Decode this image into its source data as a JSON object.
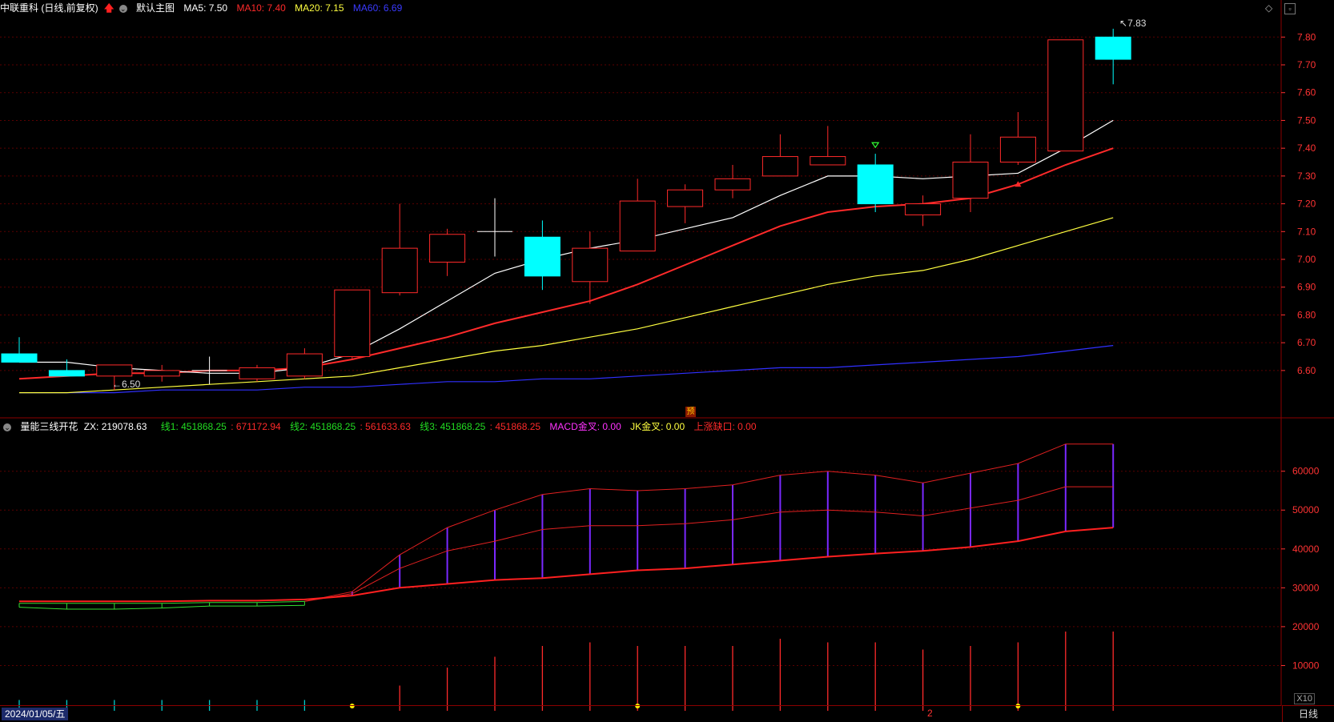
{
  "header": {
    "stock_name": "中联重科 (日线,前复权)",
    "template_label": "默认主图",
    "ma5": "MA5: 7.50",
    "ma10": "MA10: 7.40",
    "ma20": "MA20: 7.15",
    "ma60": "MA60: 6.69",
    "colors": {
      "ma5": "#ffffff",
      "ma10": "#ff2a2a",
      "ma20": "#ffff40",
      "ma60": "#3030ff"
    }
  },
  "indicator": {
    "name": "量能三线开花",
    "zx": "ZX: 219078.63",
    "line1": "线1: 451868.25",
    "line1b": ": 671172.94",
    "line2": "线2: 451868.25",
    "line2b": ": 561633.63",
    "line3": "线3: 451868.25",
    "line3b": ": 451868.25",
    "macd": "MACD金叉: 0.00",
    "jk": "JK金叉: 0.00",
    "gap": "上涨缺口: 0.00"
  },
  "price_axis_labels": [
    "7.80",
    "7.70",
    "7.60",
    "7.50",
    "7.40",
    "7.30",
    "7.20",
    "7.10",
    "7.00",
    "6.90",
    "6.80",
    "6.70",
    "6.60"
  ],
  "indicator_axis_labels": [
    "60000",
    "50000",
    "40000",
    "30000",
    "20000",
    "10000"
  ],
  "annotations": {
    "high_label": "7.83",
    "low_label": "6.50",
    "pre_badge": "预"
  },
  "footer": {
    "date": "2024/01/05/五",
    "period": "日线",
    "multiplier": "X10",
    "page_marker": "2"
  },
  "chart_data": {
    "type": "candlestick",
    "candles": [
      {
        "o": 6.66,
        "h": 6.72,
        "l": 6.63,
        "c": 6.63
      },
      {
        "o": 6.6,
        "h": 6.64,
        "l": 6.59,
        "c": 6.58
      },
      {
        "o": 6.58,
        "h": 6.62,
        "l": 6.53,
        "c": 6.62
      },
      {
        "o": 6.58,
        "h": 6.62,
        "l": 6.56,
        "c": 6.6
      },
      {
        "o": 6.6,
        "h": 6.65,
        "l": 6.55,
        "c": 6.6
      },
      {
        "o": 6.57,
        "h": 6.62,
        "l": 6.56,
        "c": 6.61
      },
      {
        "o": 6.58,
        "h": 6.68,
        "l": 6.57,
        "c": 6.66
      },
      {
        "o": 6.65,
        "h": 6.89,
        "l": 6.64,
        "c": 6.89
      },
      {
        "o": 6.88,
        "h": 7.2,
        "l": 6.87,
        "c": 7.04
      },
      {
        "o": 6.99,
        "h": 7.11,
        "l": 6.94,
        "c": 7.09
      },
      {
        "o": 7.1,
        "h": 7.22,
        "l": 7.01,
        "c": 7.1
      },
      {
        "o": 7.08,
        "h": 7.14,
        "l": 6.89,
        "c": 6.94
      },
      {
        "o": 6.92,
        "h": 7.1,
        "l": 6.84,
        "c": 7.04
      },
      {
        "o": 7.03,
        "h": 7.29,
        "l": 7.03,
        "c": 7.21
      },
      {
        "o": 7.19,
        "h": 7.27,
        "l": 7.13,
        "c": 7.25
      },
      {
        "o": 7.25,
        "h": 7.34,
        "l": 7.22,
        "c": 7.29
      },
      {
        "o": 7.3,
        "h": 7.45,
        "l": 7.3,
        "c": 7.37
      },
      {
        "o": 7.34,
        "h": 7.48,
        "l": 7.34,
        "c": 7.37
      },
      {
        "o": 7.34,
        "h": 7.38,
        "l": 7.17,
        "c": 7.2
      },
      {
        "o": 7.16,
        "h": 7.23,
        "l": 7.12,
        "c": 7.2
      },
      {
        "o": 7.22,
        "h": 7.45,
        "l": 7.17,
        "c": 7.35
      },
      {
        "o": 7.35,
        "h": 7.53,
        "l": 7.34,
        "c": 7.44
      },
      {
        "o": 7.39,
        "h": 7.79,
        "l": 7.39,
        "c": 7.79
      },
      {
        "o": 7.8,
        "h": 7.83,
        "l": 7.63,
        "c": 7.72
      }
    ],
    "ma5": [
      6.63,
      6.63,
      6.61,
      6.6,
      6.59,
      6.59,
      6.61,
      6.66,
      6.75,
      6.85,
      6.95,
      7.0,
      7.04,
      7.07,
      7.11,
      7.15,
      7.23,
      7.3,
      7.3,
      7.29,
      7.3,
      7.31,
      7.4,
      7.5
    ],
    "ma10": [
      6.57,
      6.58,
      6.59,
      6.59,
      6.6,
      6.6,
      6.61,
      6.64,
      6.68,
      6.72,
      6.77,
      6.81,
      6.85,
      6.91,
      6.98,
      7.05,
      7.12,
      7.17,
      7.19,
      7.2,
      7.22,
      7.27,
      7.34,
      7.4
    ],
    "ma20": [
      6.52,
      6.52,
      6.53,
      6.54,
      6.55,
      6.56,
      6.57,
      6.58,
      6.61,
      6.64,
      6.67,
      6.69,
      6.72,
      6.75,
      6.79,
      6.83,
      6.87,
      6.91,
      6.94,
      6.96,
      7.0,
      7.05,
      7.1,
      7.15
    ],
    "ma60": [
      6.52,
      6.52,
      6.52,
      6.53,
      6.53,
      6.53,
      6.54,
      6.54,
      6.55,
      6.56,
      6.56,
      6.57,
      6.57,
      6.58,
      6.59,
      6.6,
      6.61,
      6.61,
      6.62,
      6.63,
      6.64,
      6.65,
      6.67,
      6.69
    ],
    "price_range": [
      6.47,
      7.87
    ],
    "ind_line1": [
      25500,
      25500,
      25500,
      26000,
      26500,
      26500,
      26500,
      29000,
      38500,
      45500,
      50000,
      54000,
      55500,
      55000,
      55500,
      56500,
      59000,
      60000,
      59000,
      57000,
      59500,
      62000,
      67000,
      67000
    ],
    "ind_line2": [
      25500,
      25500,
      25500,
      26000,
      26500,
      26500,
      26500,
      28500,
      35000,
      39500,
      42000,
      45000,
      46000,
      46000,
      46500,
      47500,
      49500,
      50000,
      49500,
      48500,
      50500,
      52500,
      56000,
      56000
    ],
    "ind_line3": [
      26500,
      26500,
      26500,
      26500,
      26700,
      26700,
      27000,
      28000,
      30000,
      31000,
      32000,
      32500,
      33500,
      34500,
      35000,
      36000,
      37000,
      38000,
      38800,
      39500,
      40500,
      42000,
      44500,
      45500
    ],
    "ind_green_upper": [
      26000,
      26000,
      26000,
      26000,
      26200,
      26200,
      26500
    ],
    "ind_green_lower": [
      25000,
      24500,
      24500,
      24800,
      25300,
      25300,
      25500
    ],
    "volume_bars": [
      3,
      3,
      3,
      3,
      3,
      3,
      3,
      0,
      7,
      12,
      15,
      18,
      19,
      18,
      18,
      18,
      20,
      19,
      19,
      17,
      18,
      19,
      22,
      22
    ],
    "vol_dots": [
      7,
      13,
      21
    ],
    "ind_range": [
      0,
      69000
    ]
  }
}
